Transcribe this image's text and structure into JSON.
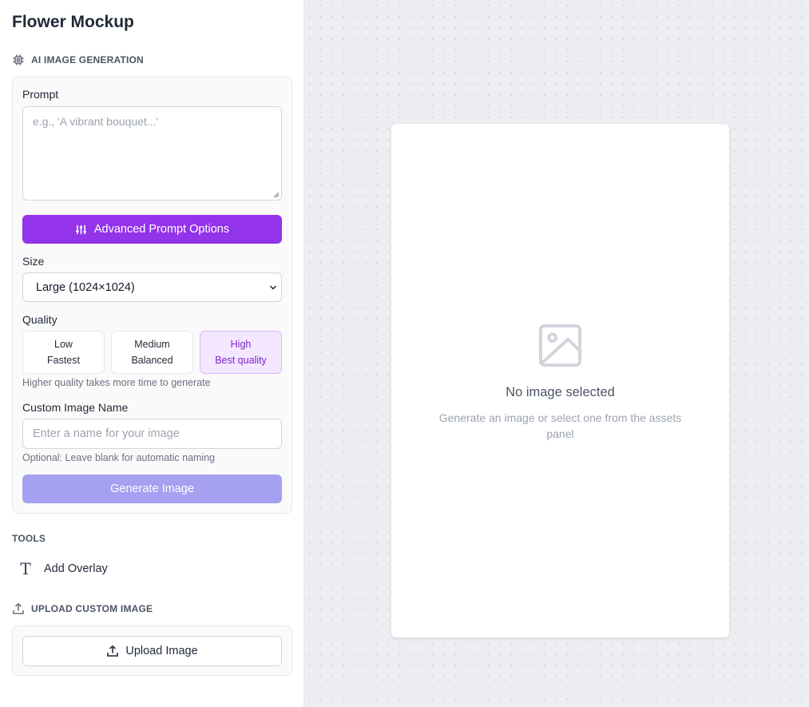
{
  "app": {
    "title": "Flower Mockup"
  },
  "ai_section": {
    "heading": "AI IMAGE GENERATION",
    "icon": "chip-icon",
    "prompt_label": "Prompt",
    "prompt_placeholder": "e.g., 'A vibrant bouquet...'",
    "advanced_button": "Advanced Prompt Options",
    "size_label": "Size",
    "size_value": "Large (1024×1024)",
    "quality_label": "Quality",
    "quality_options": [
      {
        "title": "Low",
        "subtitle": "Fastest",
        "selected": false
      },
      {
        "title": "Medium",
        "subtitle": "Balanced",
        "selected": false
      },
      {
        "title": "High",
        "subtitle": "Best quality",
        "selected": true
      }
    ],
    "quality_hint": "Higher quality takes more time to generate",
    "name_label": "Custom Image Name",
    "name_placeholder": "Enter a name for your image",
    "name_hint": "Optional: Leave blank for automatic naming",
    "generate_button": "Generate Image"
  },
  "tools": {
    "heading": "TOOLS",
    "items": [
      {
        "label": "Add Overlay",
        "icon": "text-icon"
      }
    ]
  },
  "upload_section": {
    "heading": "UPLOAD CUSTOM IMAGE",
    "button": "Upload Image"
  },
  "preview": {
    "empty_title": "No image selected",
    "empty_subtitle": "Generate an image or select one from the assets panel"
  },
  "colors": {
    "accent": "#9333ea",
    "generate_disabled": "#a5a0f0",
    "selected_bg": "#f3e8ff",
    "selected_text": "#7e22ce"
  }
}
